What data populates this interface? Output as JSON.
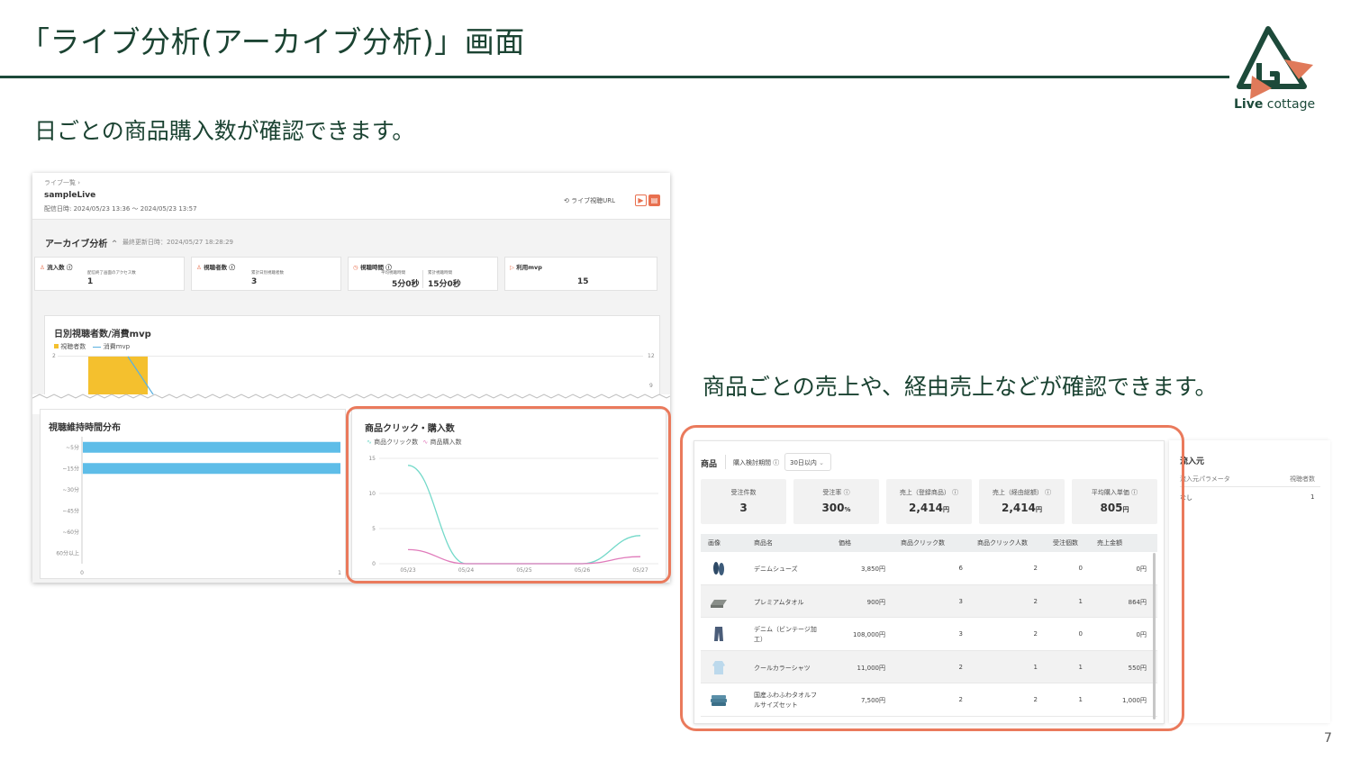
{
  "slide": {
    "title": "「ライブ分析(アーカイブ分析)」画面",
    "caption_left": "日ごとの商品購入数が確認できます。",
    "caption_right": "商品ごとの売上や、経由売上などが確認できます。",
    "page_number": "7",
    "logo_bold": "Live",
    "logo_rest": " cottage",
    "accent_color": "#1d4a3a",
    "highlight_color": "#ea7a5c"
  },
  "live_screen": {
    "breadcrumb": "ライブ一覧",
    "live_name": "sampleLive",
    "period": "配信日時: 2024/05/23 13:36 〜 2024/05/23 13:57",
    "view_url_link": "ライブ視聴URL",
    "section_title": "アーカイブ分析",
    "last_updated": "最終更新日時：2024/05/27 18:28:29",
    "stats": [
      {
        "label": "流入数",
        "sub": "配信終了画面のアクセス数",
        "value": "1"
      },
      {
        "label": "視聴者数",
        "sub": "累計日別視聴者数",
        "value": "3"
      },
      {
        "label": "視聴時間",
        "sub_a": "平均視聴時間",
        "value_a": "5分0秒",
        "sub_b": "累計視聴時間",
        "value_b": "15分0秒"
      },
      {
        "label": "利用mvp",
        "value": "15"
      }
    ],
    "daily_chart": {
      "title": "日別視聴者数/消費mvp",
      "legend": [
        "視聴者数",
        "消費mvp"
      ],
      "left_ticks": [
        "2"
      ],
      "right_ticks": [
        "12",
        "9"
      ]
    },
    "retention_chart": {
      "title": "視聴維持時間分布",
      "categories": [
        "~5分",
        "~15分",
        "~30分",
        "~45分",
        "~60分",
        "60分以上"
      ],
      "values": [
        1,
        1,
        0,
        0,
        0,
        0
      ],
      "x_ticks": [
        "0",
        "1"
      ]
    }
  },
  "chart_data": {
    "type": "line",
    "title": "商品クリック・購入数",
    "x": [
      "05/23",
      "05/24",
      "05/25",
      "05/26",
      "05/27"
    ],
    "ylim": [
      0,
      15
    ],
    "y_ticks": [
      "0",
      "5",
      "10",
      "15"
    ],
    "series": [
      {
        "name": "商品クリック数",
        "values": [
          14,
          0,
          0,
          0,
          4
        ],
        "color": "#73d9c9"
      },
      {
        "name": "商品購入数",
        "values": [
          2,
          0,
          0,
          0,
          1
        ],
        "color": "#e07bbb"
      }
    ]
  },
  "product_screen": {
    "tab_label": "商品",
    "period_label": "購入検討期間",
    "period_value": "30日以内",
    "kpis": [
      {
        "label": "受注件数",
        "value": "3",
        "unit": ""
      },
      {
        "label": "受注率",
        "value": "300",
        "unit": "%"
      },
      {
        "label": "売上（登録商品）",
        "value": "2,414",
        "unit": "円"
      },
      {
        "label": "売上（経由総額）",
        "value": "2,414",
        "unit": "円"
      },
      {
        "label": "平均購入単価",
        "value": "805",
        "unit": "円"
      }
    ],
    "columns": [
      "画像",
      "商品名",
      "価格",
      "商品クリック数",
      "商品クリック人数",
      "受注個数",
      "売上金額"
    ],
    "rows": [
      {
        "name1": "デニムシューズ",
        "name2": "",
        "price": "3,850円",
        "clicks": "6",
        "clickers": "2",
        "orders": "0",
        "sales": "0円",
        "icon": "shoes-icon"
      },
      {
        "name1": "プレミアムタオル",
        "name2": "",
        "price": "900円",
        "clicks": "3",
        "clickers": "2",
        "orders": "1",
        "sales": "864円",
        "icon": "towel-icon"
      },
      {
        "name1": "デニム（ビンテージ加",
        "name2": "工）",
        "price": "108,000円",
        "clicks": "3",
        "clickers": "2",
        "orders": "0",
        "sales": "0円",
        "icon": "jeans-icon"
      },
      {
        "name1": "クールカラーシャツ",
        "name2": "",
        "price": "11,000円",
        "clicks": "2",
        "clickers": "1",
        "orders": "1",
        "sales": "550円",
        "icon": "shirt-icon"
      },
      {
        "name1": "国産ふわふわタオルフ",
        "name2": "ルサイズセット",
        "price": "7,500円",
        "clicks": "2",
        "clickers": "2",
        "orders": "1",
        "sales": "1,000円",
        "icon": "towel-set-icon"
      }
    ]
  },
  "source_panel": {
    "title": "流入元",
    "col_param": "流入元パラメータ",
    "col_viewers": "視聴者数",
    "row_param": "なし",
    "row_value": "1"
  }
}
